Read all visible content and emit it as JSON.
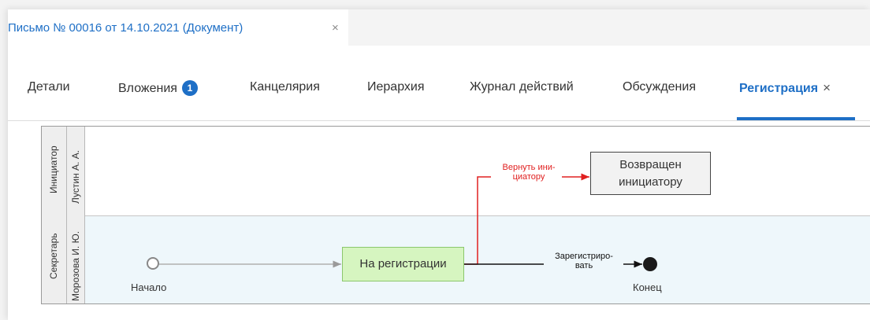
{
  "doc_tab": {
    "title": "Письмо № 00016 от 14.10.2021 (Документ)",
    "close_glyph": "×"
  },
  "tabs": [
    {
      "label": "Детали"
    },
    {
      "label": "Вложения",
      "badge": "1"
    },
    {
      "label": "Канцелярия"
    },
    {
      "label": "Иерархия"
    },
    {
      "label": "Журнал действий"
    },
    {
      "label": "Обсуждения"
    },
    {
      "label": "Регистрация",
      "active": true,
      "close_glyph": "×"
    }
  ],
  "diagram": {
    "lanes": [
      {
        "role": "Инициатор",
        "person": "Лустин А. А."
      },
      {
        "role": "Секретарь",
        "person": "Морозова И. Ю."
      }
    ],
    "nodes": {
      "start": "Начало",
      "registration": "На регистрации",
      "returned_line1": "Возвращен",
      "returned_line2": "инициатору",
      "end": "Конец"
    },
    "edges": {
      "return_line1": "Вернуть ини-",
      "return_line2": "циатору",
      "register_line1": "Зарегистриро-",
      "register_line2": "вать"
    }
  },
  "colors": {
    "accent": "#1e6fc6",
    "return_edge": "#e02020",
    "registration_fill": "#d6f5c0",
    "lane_highlight": "#eef7fb"
  }
}
